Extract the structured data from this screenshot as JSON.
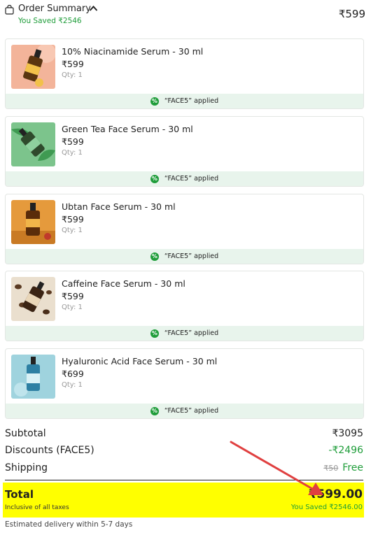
{
  "header": {
    "title": "Order Summary",
    "saved": "You Saved ₹2546",
    "price": "₹599",
    "icons": {
      "bag": "shopping-bag-icon",
      "toggle": "chevron-up-icon"
    }
  },
  "items": [
    {
      "name": "10% Niacinamide Serum - 30 ml",
      "price": "₹599",
      "qty": "Qty: 1",
      "coupon": "“FACE5” applied"
    },
    {
      "name": "Green Tea Face Serum - 30 ml",
      "price": "₹599",
      "qty": "Qty: 1",
      "coupon": "“FACE5” applied"
    },
    {
      "name": "Ubtan Face Serum - 30 ml",
      "price": "₹599",
      "qty": "Qty: 1",
      "coupon": "“FACE5” applied"
    },
    {
      "name": "Caffeine Face Serum - 30 ml",
      "price": "₹599",
      "qty": "Qty: 1",
      "coupon": "“FACE5” applied"
    },
    {
      "name": "Hyaluronic Acid Face Serum - 30 ml",
      "price": "₹699",
      "qty": "Qty: 1",
      "coupon": "“FACE5” applied"
    }
  ],
  "summary": {
    "subtotal_label": "Subtotal",
    "subtotal_value": "₹3095",
    "discount_label": "Discounts (FACE5)",
    "discount_value": "-₹2496",
    "shipping_label": "Shipping",
    "shipping_original": "₹50",
    "shipping_value": "Free"
  },
  "total": {
    "label": "Total",
    "tax_note": "Inclusive of all taxes",
    "value": "₹599.00",
    "saved": "You Saved ₹2546.00"
  },
  "delivery": "Estimated delivery within 5-7 days",
  "colors": {
    "accent_green": "#1f9d3a",
    "highlight": "#ffff00",
    "arrow": "#e04040"
  }
}
